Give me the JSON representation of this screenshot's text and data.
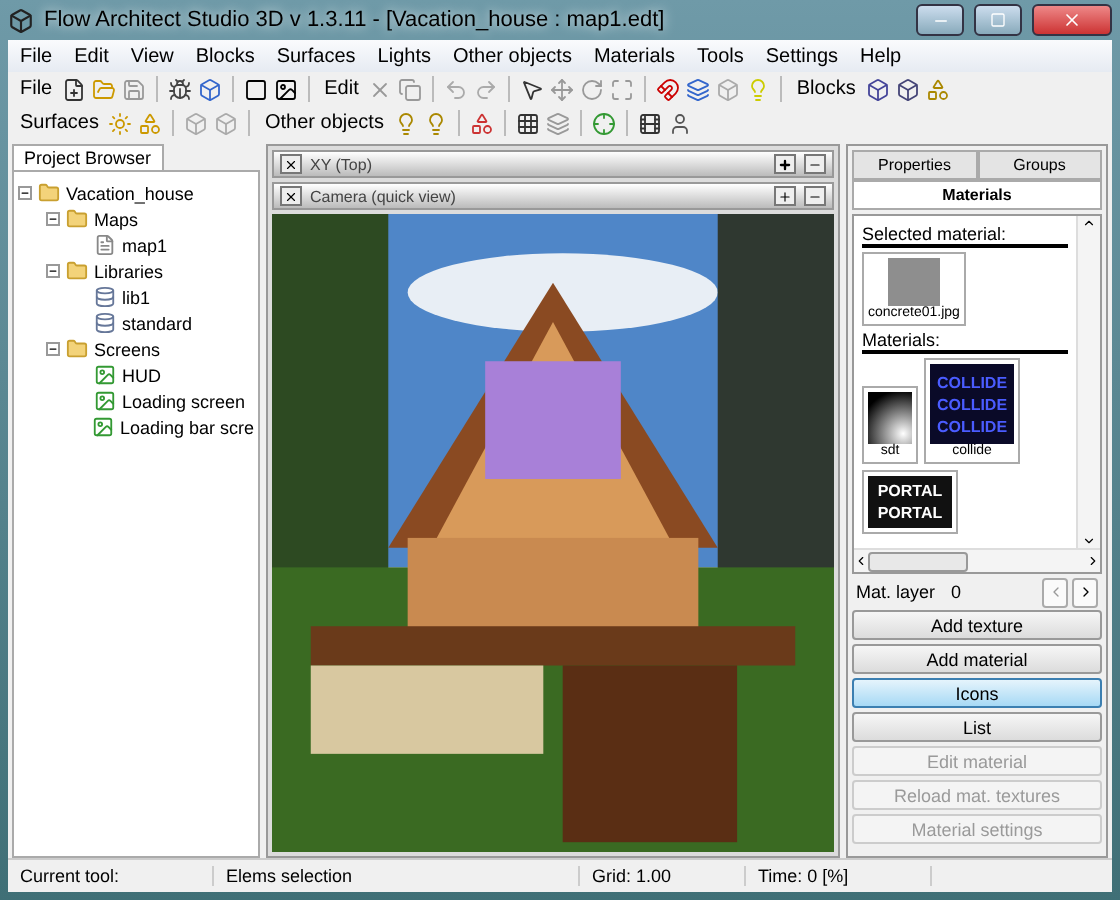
{
  "window": {
    "title": "Flow Architect Studio 3D v 1.3.11  - [Vacation_house : map1.edt]"
  },
  "menu": [
    "File",
    "Edit",
    "View",
    "Blocks",
    "Surfaces",
    "Lights",
    "Other objects",
    "Materials",
    "Tools",
    "Settings",
    "Help"
  ],
  "toolbars": [
    {
      "groups": [
        {
          "label": "File"
        },
        {
          "label": "Edit"
        },
        {
          "label": "Blocks"
        }
      ]
    },
    {
      "groups": [
        {
          "label": "Surfaces"
        },
        {
          "label": "Other objects"
        }
      ]
    }
  ],
  "project_browser": {
    "tab": "Project Browser",
    "tree": [
      {
        "label": "Vacation_house",
        "kind": "folder",
        "expanded": true,
        "children": [
          {
            "label": "Maps",
            "kind": "folder",
            "expanded": true,
            "children": [
              {
                "label": "map1",
                "kind": "map"
              }
            ]
          },
          {
            "label": "Libraries",
            "kind": "folder",
            "expanded": true,
            "children": [
              {
                "label": "lib1",
                "kind": "library"
              },
              {
                "label": "standard",
                "kind": "library"
              }
            ]
          },
          {
            "label": "Screens",
            "kind": "folder",
            "expanded": true,
            "children": [
              {
                "label": "HUD",
                "kind": "screen"
              },
              {
                "label": "Loading screen",
                "kind": "screen"
              },
              {
                "label": "Loading bar scre",
                "kind": "screen"
              }
            ]
          }
        ]
      }
    ]
  },
  "views": [
    {
      "title": "XY (Top)",
      "expanded": false
    },
    {
      "title": "Camera (quick view)",
      "expanded": true
    }
  ],
  "right_panel": {
    "tabs": [
      {
        "label": "Properties",
        "selected": false
      },
      {
        "label": "Groups",
        "selected": false
      },
      {
        "label": "Materials",
        "selected": true
      }
    ],
    "selected_material_label": "Selected material:",
    "selected_material": {
      "name": "concrete01.jpg"
    },
    "materials_label": "Materials:",
    "materials": [
      {
        "name": "sdt",
        "kind": "gradient"
      },
      {
        "name": "collide",
        "kind": "collide",
        "lines": [
          "COLLIDE",
          "COLLIDE",
          "COLLIDE"
        ]
      },
      {
        "kind": "portal",
        "lines": [
          "PORTAL",
          "PORTAL"
        ]
      }
    ],
    "mat_layer": {
      "label": "Mat. layer",
      "value": "0"
    },
    "buttons": [
      {
        "label": "Add texture",
        "selected": false,
        "disabled": false
      },
      {
        "label": "Add material",
        "selected": false,
        "disabled": false
      },
      {
        "label": "Icons",
        "selected": true,
        "disabled": false
      },
      {
        "label": "List",
        "selected": false,
        "disabled": false
      },
      {
        "label": "Edit material",
        "selected": false,
        "disabled": true
      },
      {
        "label": "Reload mat. textures",
        "selected": false,
        "disabled": true
      },
      {
        "label": "Material settings",
        "selected": false,
        "disabled": true
      }
    ]
  },
  "status_bar": {
    "tool_label": "Current tool:",
    "tool": "Elems selection",
    "grid": "Grid: 1.00",
    "time": "Time: 0 [%]"
  }
}
